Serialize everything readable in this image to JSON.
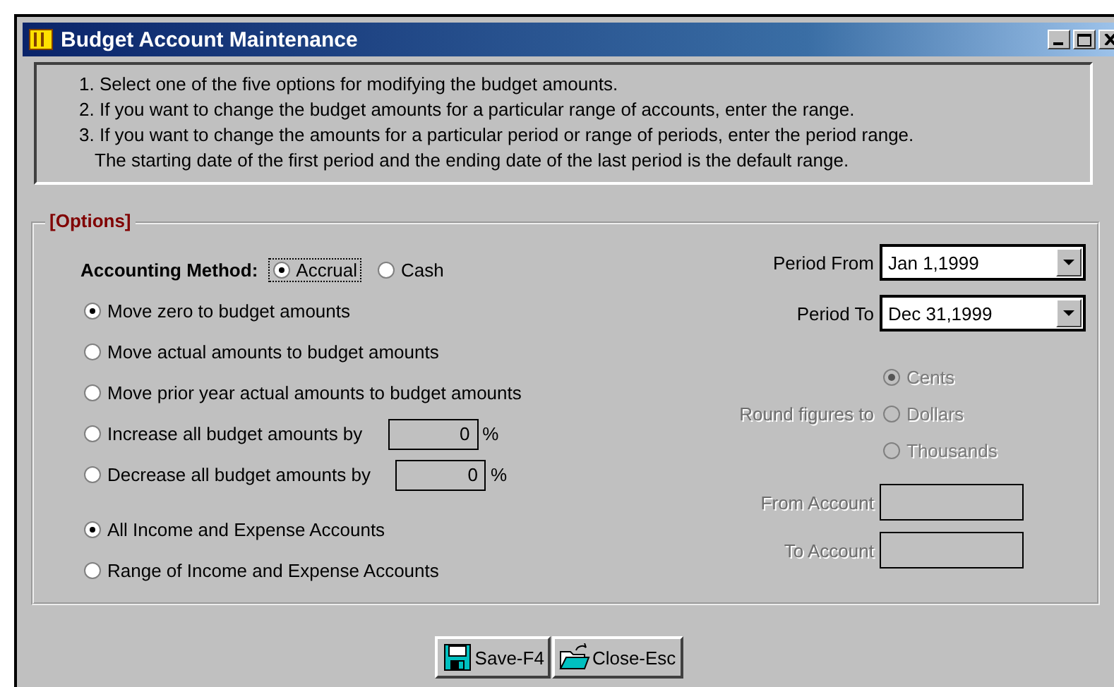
{
  "window": {
    "title": "Budget Account Maintenance"
  },
  "instructions": [
    "1. Select one of the five options for modifying the budget amounts.",
    "2. If you want to change the budget amounts for a particular range of accounts, enter the range.",
    "3. If you want to change the amounts for a particular period or range of periods, enter the period range.",
    "The starting date of the first period and the ending date of the last period is the default range."
  ],
  "options": {
    "legend": "[Options]",
    "accounting_method": {
      "label": "Accounting Method:",
      "choices": [
        {
          "label": "Accrual",
          "selected": true
        },
        {
          "label": "Cash",
          "selected": false
        }
      ]
    },
    "budget_options": [
      {
        "kind": "plain",
        "label": "Move zero to budget amounts",
        "selected": true
      },
      {
        "kind": "plain",
        "label": "Move actual amounts to budget amounts",
        "selected": false
      },
      {
        "kind": "plain",
        "label": "Move prior year actual amounts to budget amounts",
        "selected": false
      },
      {
        "kind": "percent",
        "label": "Increase all budget amounts by",
        "selected": false,
        "value": "0",
        "unit": "%"
      },
      {
        "kind": "percent",
        "label": "Decrease all budget amounts by",
        "selected": false,
        "value": "0",
        "unit": "%"
      }
    ],
    "account_scope": [
      {
        "label": "All Income and Expense Accounts",
        "selected": true
      },
      {
        "label": "Range of Income and Expense Accounts",
        "selected": false
      }
    ],
    "period_from": {
      "label": "Period From",
      "value": "Jan 1,1999"
    },
    "period_to": {
      "label": "Period To",
      "value": "Dec 31,1999"
    },
    "rounding": {
      "label": "Round figures to",
      "disabled": true,
      "choices": [
        {
          "label": "Cents",
          "selected": true
        },
        {
          "label": "Dollars",
          "selected": false
        },
        {
          "label": "Thousands",
          "selected": false
        }
      ]
    },
    "from_account": {
      "label": "From Account",
      "disabled": true
    },
    "to_account": {
      "label": "To Account",
      "disabled": true
    }
  },
  "buttons": [
    {
      "kind": "save",
      "label": "Save-F4"
    },
    {
      "kind": "close",
      "label": "Close-Esc"
    }
  ]
}
